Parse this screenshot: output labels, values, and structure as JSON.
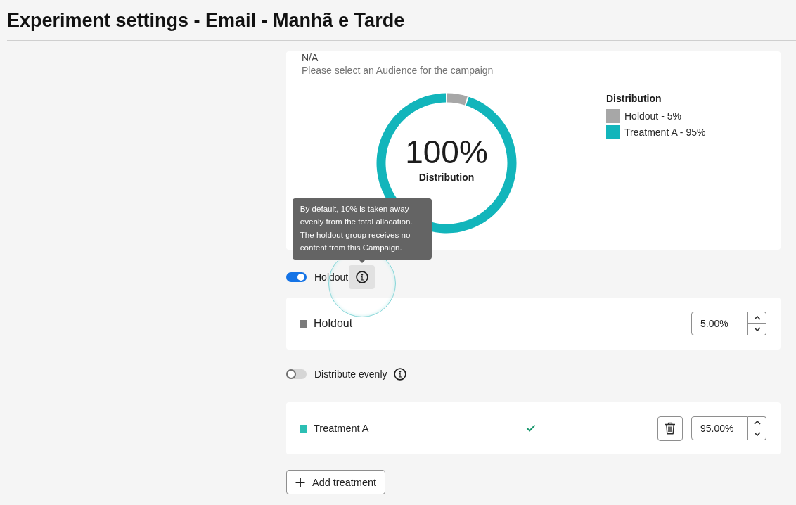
{
  "title": "Experiment settings - Email - Manhã e Tarde",
  "audience": {
    "value": "N/A",
    "hint": "Please select an Audience for the campaign"
  },
  "distribution_chart": {
    "chart_data": {
      "type": "donut",
      "categories": [
        "Holdout - 5%",
        "Treatment A - 95%"
      ],
      "values": [
        5,
        95
      ],
      "legend": "right"
    },
    "slices": [
      {
        "color": "#a7a7a7"
      },
      {
        "color": "#12b5bb"
      }
    ],
    "center_value": "100%",
    "center_label": "Distribution",
    "legend_title": "Distribution"
  },
  "holdout_toggle": {
    "label": "Holdout",
    "on": true,
    "tooltip": "By default, 10% is taken away evenly from the total allocation. The holdout group receives no content from this Campaign."
  },
  "holdout": {
    "label": "Holdout",
    "color": "#7b7b7b",
    "value": "5.00%"
  },
  "distribute_toggle": {
    "label": "Distribute evenly",
    "on": false
  },
  "treatments": [
    {
      "name": "Treatment A",
      "color": "#2cbfb4",
      "valid": true,
      "value": "95.00%"
    }
  ],
  "add_button": {
    "label": "Add treatment"
  }
}
